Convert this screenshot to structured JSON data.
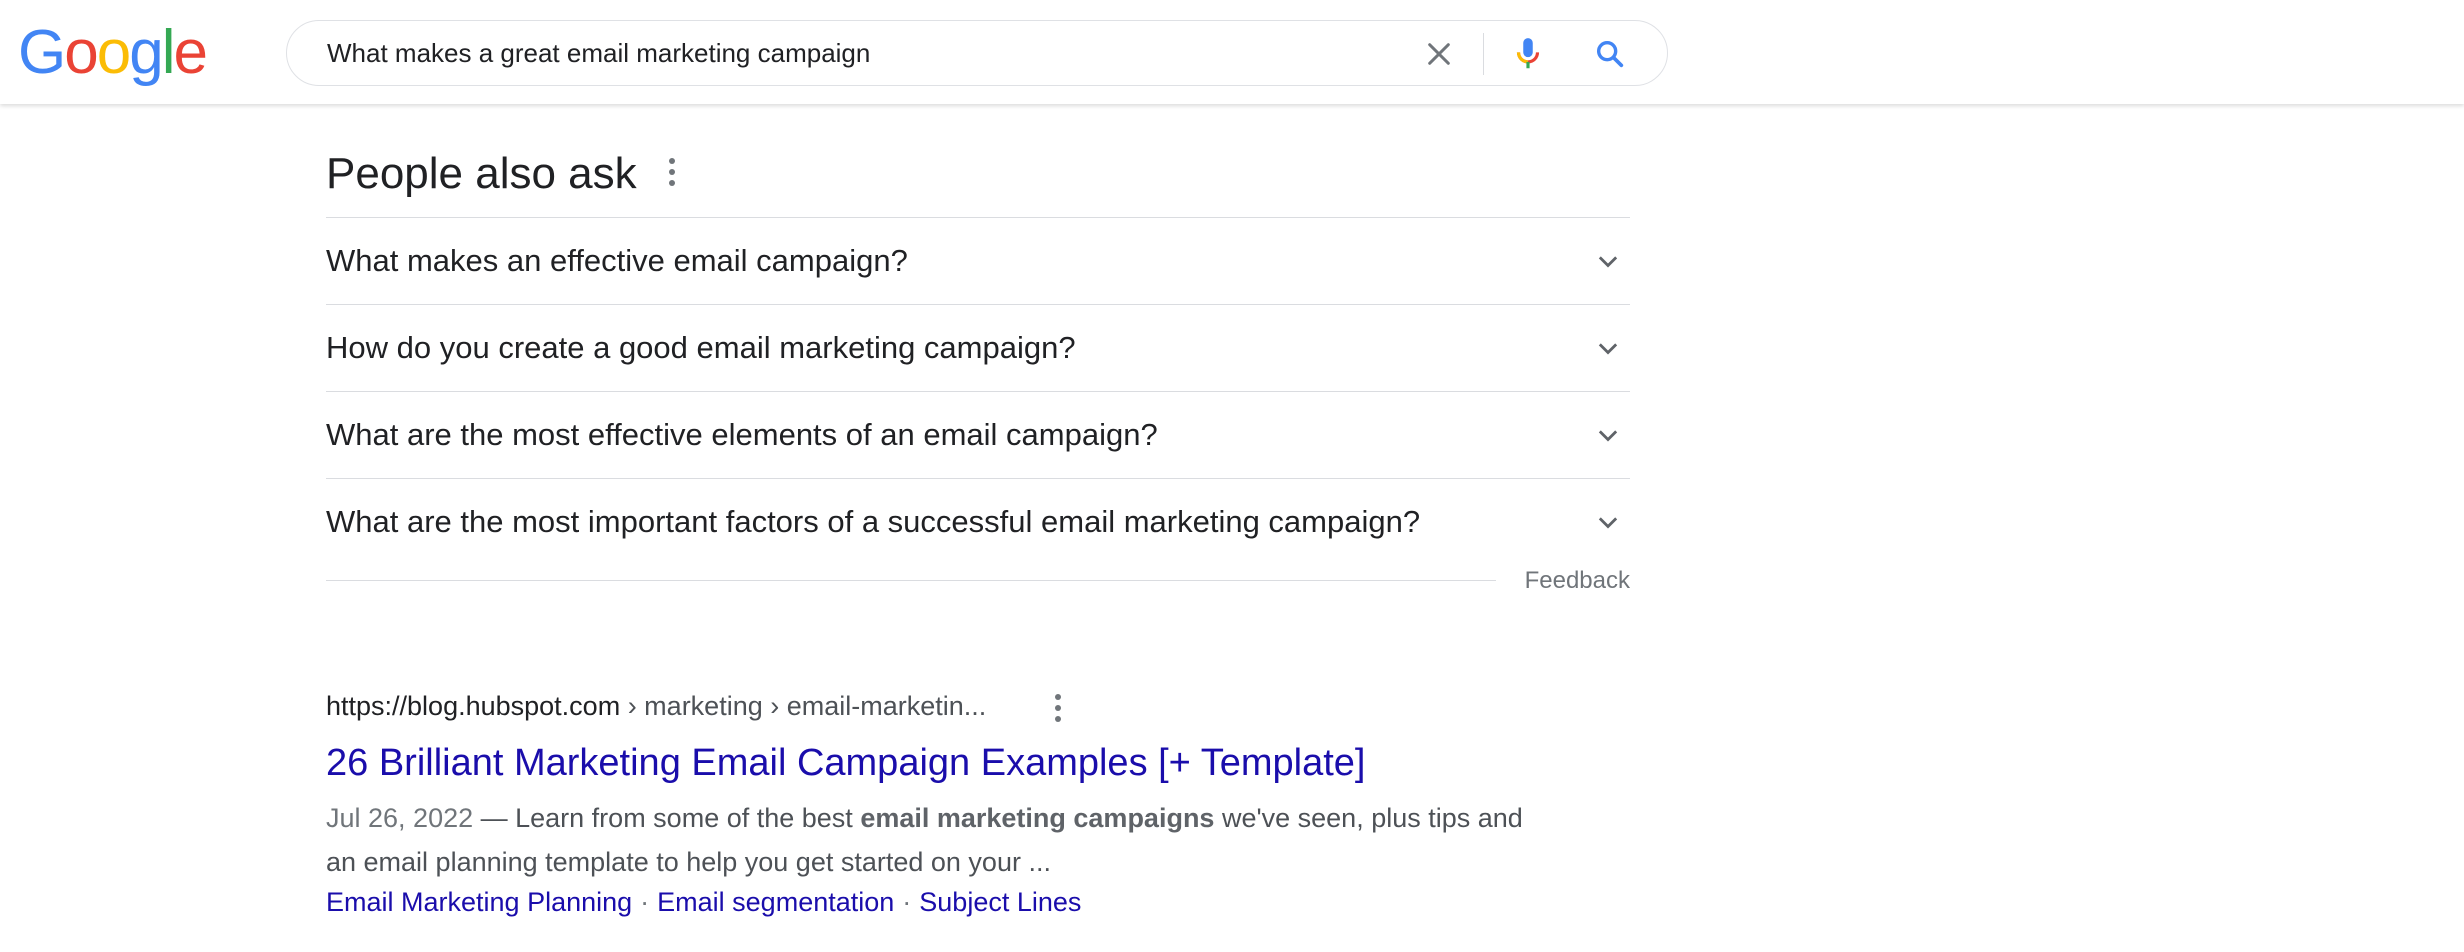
{
  "header": {
    "logo_letters": [
      {
        "ch": "G",
        "color": "#4285F4"
      },
      {
        "ch": "o",
        "color": "#EA4335"
      },
      {
        "ch": "o",
        "color": "#FBBC05"
      },
      {
        "ch": "g",
        "color": "#4285F4"
      },
      {
        "ch": "l",
        "color": "#34A853"
      },
      {
        "ch": "e",
        "color": "#EA4335"
      }
    ],
    "search_query": "What makes a great email marketing campaign",
    "icons": [
      "close-icon",
      "mic-icon",
      "search-icon"
    ]
  },
  "people_also_ask": {
    "title": "People also ask",
    "questions": [
      "What makes an effective email campaign?",
      "How do you create a good email marketing campaign?",
      "What are the most effective elements of an email campaign?",
      "What are the most important factors of a successful email marketing campaign?"
    ],
    "feedback_label": "Feedback"
  },
  "result": {
    "site_url": "https://blog.hubspot.com",
    "breadcrumb": " › marketing › email-marketin...",
    "title": "26 Brilliant Marketing Email Campaign Examples [+ Template]",
    "date": "Jul 26, 2022",
    "snippet_pre": " — Learn from some of the best ",
    "snippet_bold": "email marketing campaigns",
    "snippet_post": " we've seen, plus tips and an email planning template to help you get started on your ...",
    "sitelinks": [
      "Email Marketing Planning",
      "Email segmentation",
      "Subject Lines"
    ]
  },
  "colors": {
    "link": "#1a0dab",
    "text": "#202124",
    "muted": "#70757a",
    "divider": "#dadce0"
  }
}
